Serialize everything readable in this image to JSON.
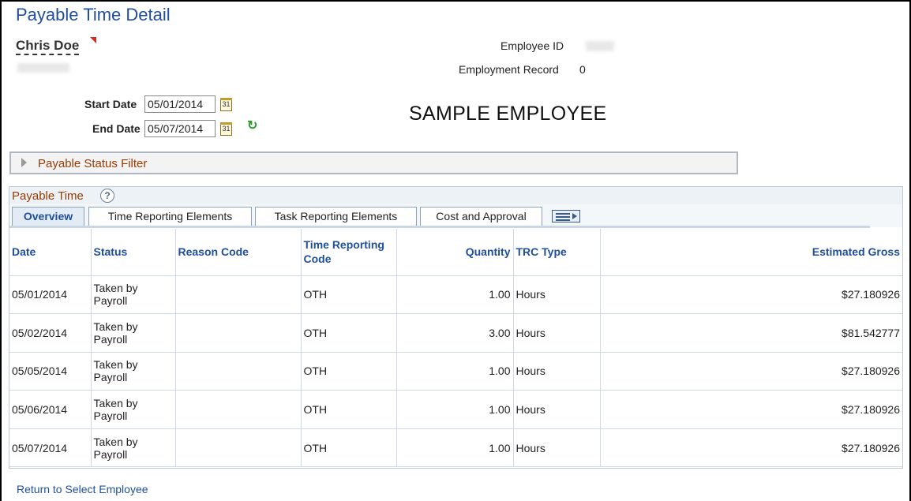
{
  "page": {
    "title": "Payable Time Detail",
    "sample_label": "SAMPLE EMPLOYEE"
  },
  "employee": {
    "name": "Chris Doe",
    "employee_id_label": "Employee ID",
    "employment_record_label": "Employment Record",
    "employment_record_value": "0"
  },
  "dates": {
    "start_label": "Start Date",
    "start_value": "05/01/2014",
    "end_label": "End Date",
    "end_value": "05/07/2014",
    "calendar_glyph": "31"
  },
  "filter": {
    "label": "Payable Status Filter"
  },
  "grid": {
    "title": "Payable Time",
    "help_glyph": "?",
    "tabs": [
      {
        "label": "Overview"
      },
      {
        "label": "Time Reporting Elements"
      },
      {
        "label": "Task Reporting Elements"
      },
      {
        "label": "Cost and Approval"
      }
    ],
    "columns": [
      "Date",
      "Status",
      "Reason Code",
      "Time Reporting Code",
      "Quantity",
      "TRC Type",
      "Estimated Gross"
    ],
    "rows": [
      {
        "date": "05/01/2014",
        "status": "Taken by Payroll",
        "reason": "",
        "trc": "OTH",
        "quantity": "1.00",
        "trc_type": "Hours",
        "gross": "$27.180926"
      },
      {
        "date": "05/02/2014",
        "status": "Taken by Payroll",
        "reason": "",
        "trc": "OTH",
        "quantity": "3.00",
        "trc_type": "Hours",
        "gross": "$81.542777"
      },
      {
        "date": "05/05/2014",
        "status": "Taken by Payroll",
        "reason": "",
        "trc": "OTH",
        "quantity": "1.00",
        "trc_type": "Hours",
        "gross": "$27.180926"
      },
      {
        "date": "05/06/2014",
        "status": "Taken by Payroll",
        "reason": "",
        "trc": "OTH",
        "quantity": "1.00",
        "trc_type": "Hours",
        "gross": "$27.180926"
      },
      {
        "date": "05/07/2014",
        "status": "Taken by Payroll",
        "reason": "",
        "trc": "OTH",
        "quantity": "1.00",
        "trc_type": "Hours",
        "gross": "$27.180926"
      }
    ]
  },
  "footer": {
    "return_link": "Return to Select Employee"
  },
  "icons": {
    "calendar": "calendar-icon",
    "refresh": "refresh-icon",
    "expand": "expand-arrow-icon",
    "help": "help-icon",
    "grid_view": "show-all-columns-icon"
  },
  "colors": {
    "title_blue": "#1f4e9c",
    "section_brown": "#993a00",
    "refresh_green": "#2e9a2e"
  }
}
